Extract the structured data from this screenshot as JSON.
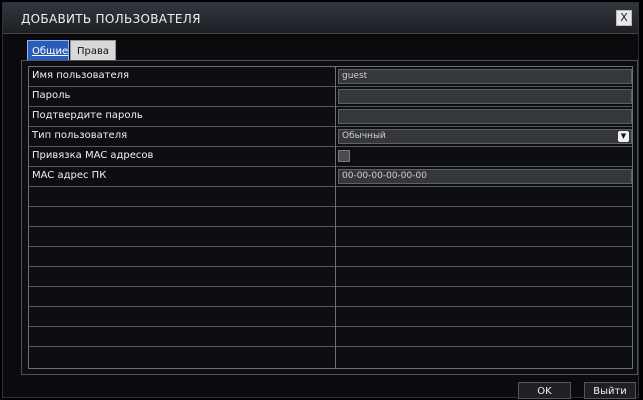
{
  "dialog": {
    "title": "ДОБАВИТЬ ПОЛЬЗОВАТЕЛЯ",
    "close_glyph": "X"
  },
  "tabs": [
    {
      "label": "Общие",
      "active": true
    },
    {
      "label": "Права",
      "active": false
    }
  ],
  "form": {
    "rows": [
      {
        "label": "Имя пользователя",
        "type": "text",
        "value": "guest"
      },
      {
        "label": "Пароль",
        "type": "password",
        "value": ""
      },
      {
        "label": "Подтвердите пароль",
        "type": "password",
        "value": ""
      },
      {
        "label": "Тип пользователя",
        "type": "select",
        "value": "Обычный"
      },
      {
        "label": "Привязка MAC адресов",
        "type": "checkbox",
        "checked": false
      },
      {
        "label": "MAC адрес ПК",
        "type": "text",
        "value": "00-00-00-00-00-00"
      }
    ],
    "empty_rows": 10
  },
  "footer": {
    "ok_label": "OK",
    "exit_label": "Выйти"
  },
  "colors": {
    "tab_active_bg": "#2a5db8",
    "background": "#0b0b0e"
  }
}
